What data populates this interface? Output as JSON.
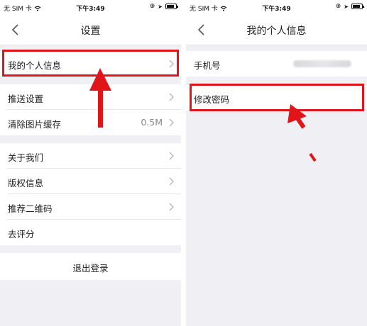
{
  "status_bar": {
    "carrier": "无 SIM 卡",
    "time": "下午3:49",
    "icons": [
      "wifi-icon",
      "lock-rotation-icon",
      "location-arrow-icon",
      "battery-icon"
    ]
  },
  "settings_screen": {
    "title": "设置",
    "items": [
      {
        "label": "我的个人信息",
        "value": "",
        "chevron": true
      },
      {
        "label": "推送设置",
        "value": "",
        "chevron": true
      },
      {
        "label": "清除图片缓存",
        "value": "0.5M",
        "chevron": true
      },
      {
        "label": "关于我们",
        "value": "",
        "chevron": true
      },
      {
        "label": "版权信息",
        "value": "",
        "chevron": true
      },
      {
        "label": "推荐二维码",
        "value": "",
        "chevron": true
      },
      {
        "label": "去评分",
        "value": "",
        "chevron": false
      }
    ],
    "logout": "退出登录"
  },
  "profile_screen": {
    "title": "我的个人信息",
    "phone_label": "手机号",
    "change_password": "修改密码"
  },
  "colors": {
    "highlight": "#e1141a",
    "background": "#efeff4",
    "cell": "#ffffff"
  }
}
